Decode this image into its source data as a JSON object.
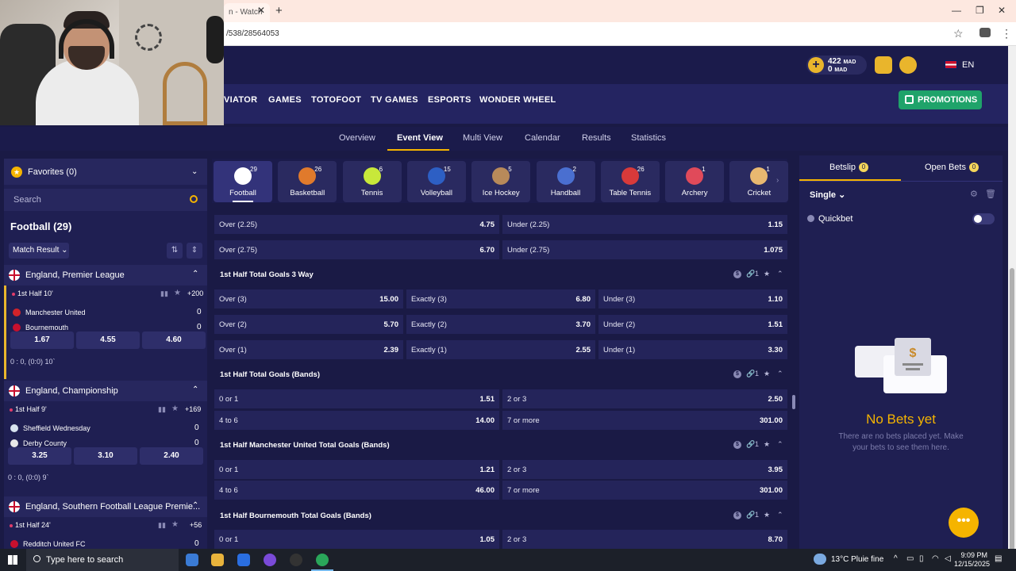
{
  "browser": {
    "tab_title": "n - Watch",
    "url": "/538/28564053"
  },
  "header": {
    "balance": "422",
    "balance_currency": "MAD",
    "bonus": "0",
    "bonus_currency": "MAD",
    "language": "EN"
  },
  "main_nav": {
    "items": [
      "VIATOR",
      "GAMES",
      "TOTOFOOT",
      "TV GAMES",
      "ESPORTS",
      "WONDER WHEEL"
    ],
    "promotions": "PROMOTIONS"
  },
  "sub_nav": {
    "items": [
      "Overview",
      "Event View",
      "Multi View",
      "Calendar",
      "Results",
      "Statistics"
    ],
    "active": "Event View"
  },
  "sidebar": {
    "favorites": "Favorites (0)",
    "search_placeholder": "Search",
    "sport_title": "Football (29)",
    "market_select": "Match Result",
    "leagues": [
      {
        "name": "England, Premier League",
        "match": {
          "period": "1st Half 10'",
          "more": "+200",
          "home": "Manchester United",
          "home_score": "0",
          "away": "Bournemouth",
          "away_score": "0",
          "odds": [
            "1.67",
            "4.55",
            "4.60"
          ],
          "ht": "0 : 0, (0:0) 10`"
        }
      },
      {
        "name": "England, Championship",
        "match": {
          "period": "1st Half 9'",
          "more": "+169",
          "home": "Sheffield Wednesday",
          "home_score": "0",
          "away": "Derby County",
          "away_score": "0",
          "odds": [
            "3.25",
            "3.10",
            "2.40"
          ],
          "ht": "0 : 0, (0:0) 9`"
        }
      },
      {
        "name": "England, Southern Football League Premie...",
        "match": {
          "period": "1st Half 24'",
          "more": "+56",
          "home": "Redditch United FC",
          "home_score": "0"
        }
      }
    ]
  },
  "sports": [
    {
      "name": "Football",
      "count": "29",
      "color": "#ffffff"
    },
    {
      "name": "Basketball",
      "count": "26",
      "color": "#e07a2c"
    },
    {
      "name": "Tennis",
      "count": "6",
      "color": "#c8e83a"
    },
    {
      "name": "Volleyball",
      "count": "15",
      "color": "#2d5fc4"
    },
    {
      "name": "Ice Hockey",
      "count": "5",
      "color": "#b88a5a"
    },
    {
      "name": "Handball",
      "count": "2",
      "color": "#4a6fd0"
    },
    {
      "name": "Table Tennis",
      "count": "26",
      "color": "#d83a3a"
    },
    {
      "name": "Archery",
      "count": "1",
      "color": "#e04a5a"
    },
    {
      "name": "Cricket",
      "count": "1",
      "color": "#e8b870"
    }
  ],
  "markets": {
    "top_rows": [
      [
        {
          "label": "Over (2.25)",
          "odd": "4.75"
        },
        {
          "label": "Under (2.25)",
          "odd": "1.15"
        }
      ],
      [
        {
          "label": "Over (2.75)",
          "odd": "6.70"
        },
        {
          "label": "Under (2.75)",
          "odd": "1.075"
        }
      ]
    ],
    "three_way": {
      "title": "1st Half Total Goals 3 Way",
      "count": "1",
      "rows": [
        [
          {
            "label": "Over (3)",
            "odd": "15.00"
          },
          {
            "label": "Exactly (3)",
            "odd": "6.80"
          },
          {
            "label": "Under (3)",
            "odd": "1.10"
          }
        ],
        [
          {
            "label": "Over (2)",
            "odd": "5.70"
          },
          {
            "label": "Exactly (2)",
            "odd": "3.70"
          },
          {
            "label": "Under (2)",
            "odd": "1.51"
          }
        ],
        [
          {
            "label": "Over (1)",
            "odd": "2.39"
          },
          {
            "label": "Exactly (1)",
            "odd": "2.55"
          },
          {
            "label": "Under (1)",
            "odd": "3.30"
          }
        ]
      ]
    },
    "bands": {
      "title": "1st Half Total Goals (Bands)",
      "count": "1",
      "rows": [
        [
          {
            "label": "0 or 1",
            "odd": "1.51"
          },
          {
            "label": "2 or 3",
            "odd": "2.50"
          }
        ],
        [
          {
            "label": "4 to 6",
            "odd": "14.00"
          },
          {
            "label": "7 or more",
            "odd": "301.00"
          }
        ]
      ]
    },
    "mu_bands": {
      "title": "1st Half Manchester United Total Goals (Bands)",
      "count": "1",
      "rows": [
        [
          {
            "label": "0 or 1",
            "odd": "1.21"
          },
          {
            "label": "2 or 3",
            "odd": "3.95"
          }
        ],
        [
          {
            "label": "4 to 6",
            "odd": "46.00"
          },
          {
            "label": "7 or more",
            "odd": "301.00"
          }
        ]
      ]
    },
    "bou_bands": {
      "title": "1st Half Bournemouth Total Goals (Bands)",
      "count": "1",
      "rows": [
        [
          {
            "label": "0 or 1",
            "odd": "1.05"
          },
          {
            "label": "2 or 3",
            "odd": "8.70"
          }
        ]
      ]
    }
  },
  "betslip": {
    "tab_betslip": "Betslip",
    "betslip_count": "0",
    "tab_open": "Open Bets",
    "open_count": "0",
    "mode": "Single",
    "quickbet": "Quickbet",
    "empty_title": "No Bets yet",
    "empty_sub": "There are no bets placed yet. Make your bets to see them here."
  },
  "taskbar": {
    "search_placeholder": "Type here to search",
    "weather": "13°C  Pluie fine",
    "time": "9:09 PM",
    "date": "12/15/2025"
  }
}
